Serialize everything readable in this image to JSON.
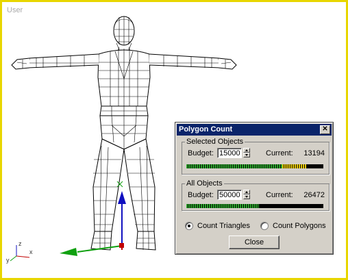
{
  "viewport": {
    "label": "User"
  },
  "axis_labels": {
    "z": "z",
    "x": "x",
    "y": "y"
  },
  "dialog": {
    "title": "Polygon Count",
    "close_glyph": "✕",
    "selected": {
      "group_title": "Selected Objects",
      "budget_label": "Budget:",
      "budget_value": "15000",
      "current_label": "Current:",
      "current_value": "13194",
      "meter_fraction": 0.88,
      "meter_green_fraction": 0.7
    },
    "all": {
      "group_title": "All Objects",
      "budget_label": "Budget:",
      "budget_value": "50000",
      "current_label": "Current:",
      "current_value": "26472",
      "meter_fraction": 0.53
    },
    "count_options": [
      {
        "label": "Count Triangles",
        "selected": true
      },
      {
        "label": "Count Polygons",
        "selected": false
      }
    ],
    "close_button_label": "Close"
  },
  "colors": {
    "viewport_border": "#e8d600",
    "title_bar": "#0a246a",
    "meter_green": "#2aa52a",
    "meter_yellow": "#e6c800",
    "gizmo_z": "#1010c0",
    "gizmo_x": "#c00000",
    "gizmo_y": "#10a010"
  }
}
